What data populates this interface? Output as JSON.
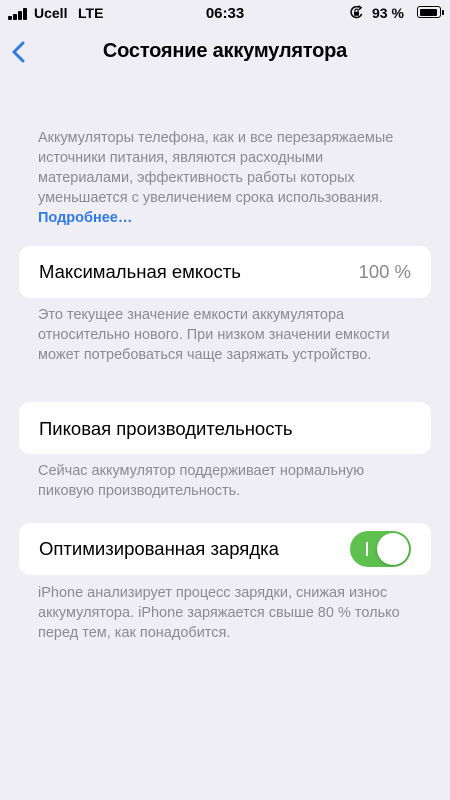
{
  "status_bar": {
    "carrier": "Ucell",
    "network": "LTE",
    "time": "06:33",
    "battery_percent": "93 %",
    "icons": [
      "signal-icon",
      "orientation-lock-icon",
      "battery-icon"
    ]
  },
  "nav": {
    "back_icon": "chevron-left-icon",
    "title": "Состояние аккумулятора"
  },
  "intro": {
    "text": "Аккумуляторы телефона, как и все перезаряжаемые источники питания, являются расходными материалами, эффективность работы которых уменьшается с увеличением срока использования.",
    "link": "Подробнее…"
  },
  "max_capacity": {
    "label": "Максимальная емкость",
    "value": "100 %",
    "description": "Это текущее значение емкости аккумулятора относительно нового. При низком значении емкости может потребоваться чаще заряжать устройство."
  },
  "peak_performance": {
    "label": "Пиковая производительность",
    "description": "Сейчас аккумулятор поддерживает нормальную пиковую производительность."
  },
  "optimized_charging": {
    "label": "Оптимизированная зарядка",
    "enabled": true,
    "description": "iPhone анализирует процесс зарядки, снижая износ аккумулятора. iPhone заряжается свыше 80 % только перед тем, как понадобится."
  },
  "colors": {
    "background": "#efeef4",
    "card": "#ffffff",
    "secondary_text": "#8a8a8f",
    "link": "#2f7be5",
    "toggle_on": "#5ec04e"
  }
}
